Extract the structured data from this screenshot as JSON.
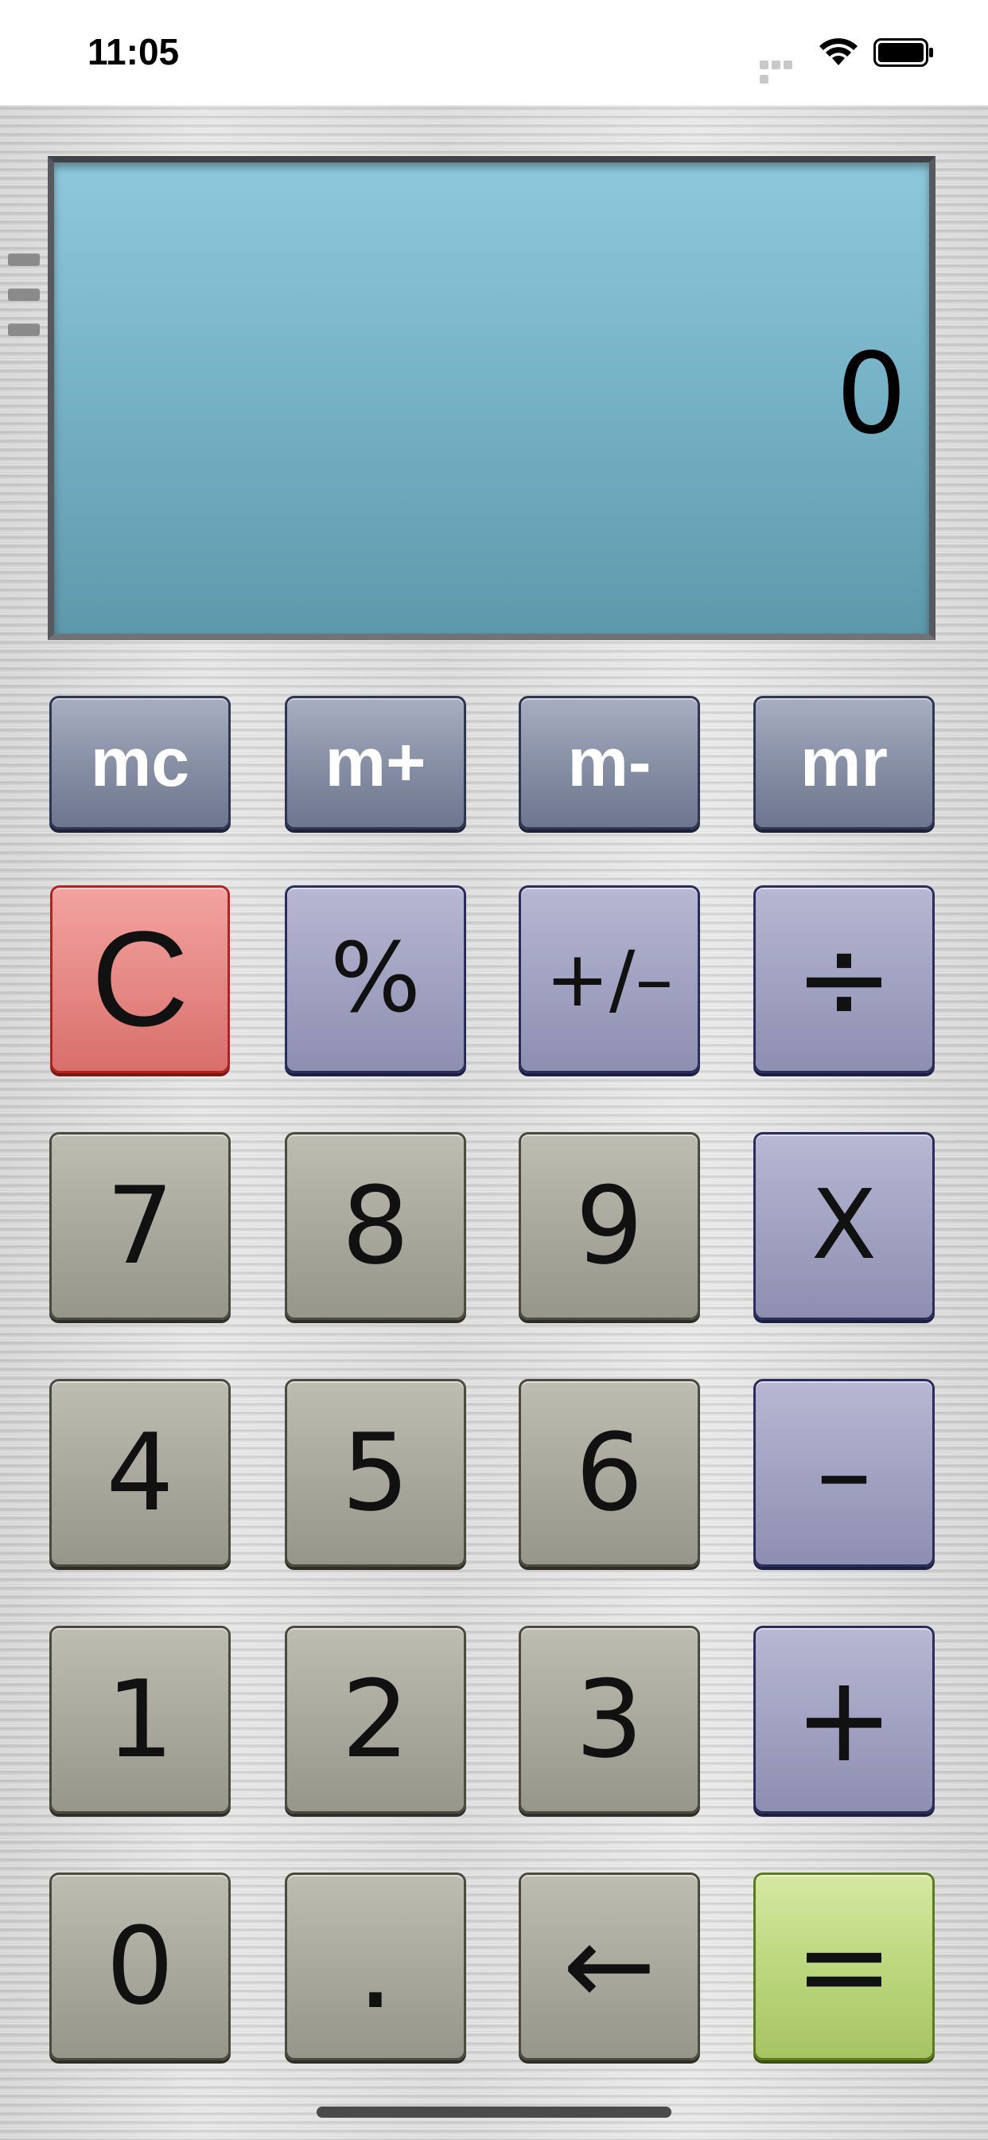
{
  "status_bar": {
    "time": "11:05"
  },
  "display": {
    "value": "0"
  },
  "memory_keys": [
    {
      "label": "mc"
    },
    {
      "label": "m+"
    },
    {
      "label": "m-"
    },
    {
      "label": "mr"
    }
  ],
  "keys": {
    "clear": "C",
    "percent": "%",
    "plus_minus": "+/–",
    "divide": "÷",
    "multiply": "X",
    "minus": "–",
    "plus": "+",
    "equals": "=",
    "decimal": ".",
    "backspace": "←",
    "seven": "7",
    "eight": "8",
    "nine": "9",
    "four": "4",
    "five": "5",
    "six": "6",
    "one": "1",
    "two": "2",
    "three": "3",
    "zero": "0"
  },
  "colors": {
    "display_top": "#8ec8dc",
    "display_bottom": "#5e98ab",
    "memory_key": "#8890a6",
    "operator_key": "#a2a2c2",
    "number_key": "#a9a99d",
    "clear_key": "#e68a86",
    "equals_key": "#bcd77d"
  },
  "icons": [
    "wifi-icon",
    "battery-icon",
    "menu-handle-icon"
  ]
}
